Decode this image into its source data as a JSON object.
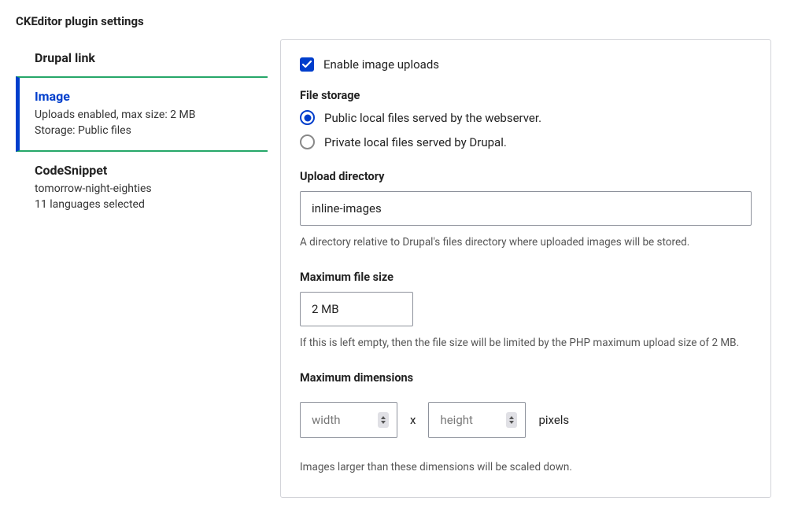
{
  "page_title": "CKEditor plugin settings",
  "tabs": [
    {
      "title": "Drupal link",
      "subtitle": ""
    },
    {
      "title": "Image",
      "subtitle": "Uploads enabled, max size: 2 MB\nStorage: Public files"
    },
    {
      "title": "CodeSnippet",
      "subtitle": "tomorrow-night-eighties\n11 languages selected"
    }
  ],
  "active_tab_index": 1,
  "panel": {
    "enable_uploads": {
      "label": "Enable image uploads",
      "checked": true
    },
    "file_storage": {
      "legend": "File storage",
      "options": [
        {
          "label": "Public local files served by the webserver.",
          "selected": true
        },
        {
          "label": "Private local files served by Drupal.",
          "selected": false
        }
      ]
    },
    "upload_directory": {
      "label": "Upload directory",
      "value": "inline-images",
      "help": "A directory relative to Drupal's files directory where uploaded images will be stored."
    },
    "max_file_size": {
      "label": "Maximum file size",
      "value": "2 MB",
      "help": "If this is left empty, then the file size will be limited by the PHP maximum upload size of 2 MB."
    },
    "max_dimensions": {
      "label": "Maximum dimensions",
      "width_placeholder": "width",
      "height_placeholder": "height",
      "separator": "x",
      "unit": "pixels",
      "help": "Images larger than these dimensions will be scaled down."
    }
  }
}
